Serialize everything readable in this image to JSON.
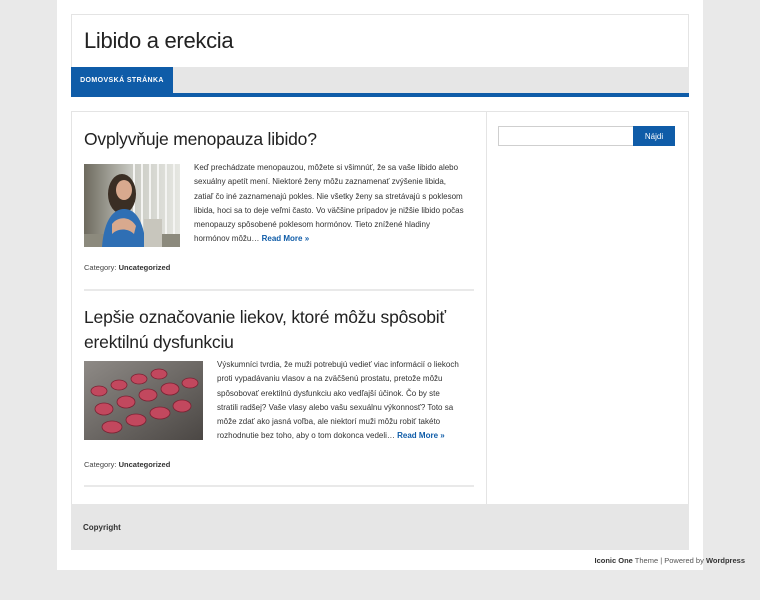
{
  "site": {
    "title": "Libido a erekcia"
  },
  "nav": {
    "items": [
      {
        "label": "Domovská stránka"
      }
    ]
  },
  "search": {
    "button_label": "Nájdi",
    "placeholder": "",
    "value": ""
  },
  "posts": [
    {
      "title": "Ovplyvňuje menopauza libido?",
      "excerpt": [
        "Keď prechádzate menopauzou, môžete si všimnúť, že sa vaše libido alebo",
        "sexuálny apetít mení. Niektoré ženy môžu zaznamenať zvýšenie libida,",
        "zatiaľ čo iné zaznamenajú pokles. Nie všetky ženy sa stretávajú s poklesom",
        "libida, hoci sa to deje veľmi často. Vo väčšine prípadov je nižšie libido počas",
        "menopauzy spôsobené poklesom hormónov. Tieto znížené hladiny",
        "hormónov môžu… "
      ],
      "read_more": "Read More »",
      "category_label": "Category:",
      "category": "Uncategorized"
    },
    {
      "title_lines": [
        "Lepšie označovanie liekov, ktoré môžu spôsobiť",
        "erektilnú dysfunkciu"
      ],
      "excerpt": [
        "Výskumníci tvrdia, že muži potrebujú vedieť viac informácií o liekoch",
        "proti vypadávaniu vlasov a na zväčšenú prostatu, pretože môžu",
        "spôsobovať erektilnú dysfunkciu ako vedľajší účinok. Čo by ste",
        "stratili radšej? Vaše vlasy alebo vašu sexuálnu výkonnosť? Toto sa",
        "môže zdať ako jasná voľba, ale niektorí muži môžu robiť takéto",
        "rozhodnutie bez toho, aby o tom dokonca vedeli… "
      ],
      "read_more": "Read More »",
      "category_label": "Category:",
      "category": "Uncategorized"
    }
  ],
  "footer": {
    "copyright": "Copyright",
    "credits_theme": "Iconic One",
    "credits_theme_suffix": " Theme | Powered by ",
    "credits_platform": "Wordpress"
  }
}
